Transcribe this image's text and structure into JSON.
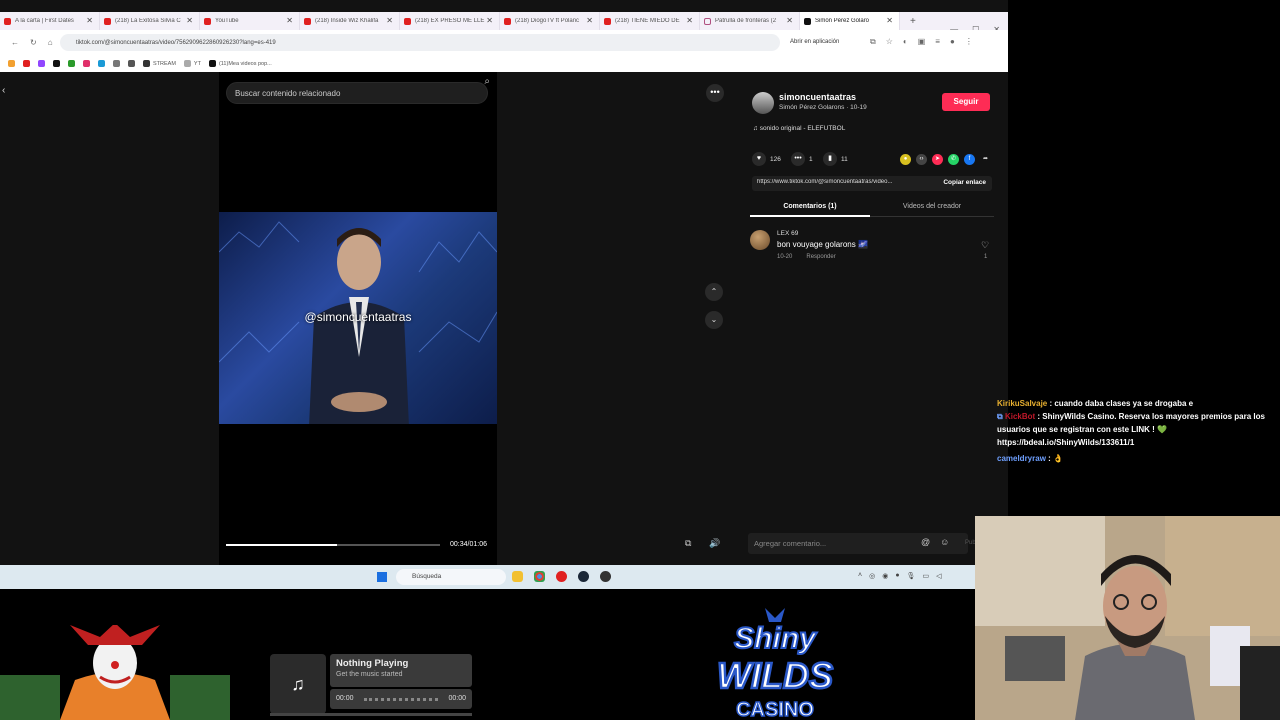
{
  "browser": {
    "tabs": [
      {
        "label": "A la carta | First Dates",
        "icon": "youtube-icon"
      },
      {
        "label": "(218) La Exitosa Silvia C",
        "icon": "youtube-icon"
      },
      {
        "label": "YouTube",
        "icon": "youtube-icon"
      },
      {
        "label": "(218) Inside Wiz Khalifa",
        "icon": "youtube-icon"
      },
      {
        "label": "(218) EX PRESO ME LLE",
        "icon": "youtube-icon"
      },
      {
        "label": "(218) DiogoTV ft Polanc",
        "icon": "youtube-icon"
      },
      {
        "label": "(218) TIENE MIEDO DE",
        "icon": "youtube-icon"
      },
      {
        "label": "Patrulla de fronteras (2",
        "icon": "page-icon"
      },
      {
        "label": "Simón Pérez Golaro",
        "icon": "tiktok-icon",
        "active": true
      }
    ],
    "url": "tiktok.com/@simoncuentaatras/video/7562909622860926230?lang=es-419",
    "open_in_app": "Abrir en aplicación",
    "bookmarks": [
      "",
      "",
      "",
      "",
      "",
      "",
      "",
      "",
      "",
      "",
      "",
      "STREAM",
      "",
      "YT",
      "(11)Mea videos pop..."
    ]
  },
  "tiktok": {
    "search_placeholder": "Buscar contenido relacionado",
    "watermark": "@simoncuentaatras",
    "progress": 0.52,
    "time": "00:34/01:06",
    "user": {
      "handle": "simoncuentaatras",
      "subtitle": "Simón Pérez Golarons · 10-19",
      "follow": "Seguir"
    },
    "sound": "sonido original - ELEFUTBOL",
    "stats": {
      "likes": "126",
      "comments": "1",
      "saves": "11"
    },
    "link": "https://www.tiktok.com/@simoncuentaatras/video...",
    "copy_link": "Copiar enlace",
    "tabs": {
      "comments": "Comentarios (1)",
      "videos": "Videos del creador"
    },
    "comment": {
      "user": "LEX 69",
      "text": "bon vouyage golarons 🌌",
      "date": "10-20",
      "reply": "Responder",
      "likes": "1"
    },
    "comment_placeholder": "Agregar comentario...",
    "post": "Publ"
  },
  "taskbar": {
    "search": "Búsqueda"
  },
  "chat": [
    {
      "user": "KirikuSalvaje",
      "text": " : cuando daba clases ya se drogaba e"
    },
    {
      "user": "KickBot",
      "text": " : ShinyWilds Casino. Reserva los mayores premios para los usuarios que se registran con este LINK ! 💚 https://bdeal.io/ShinyWilds/133611/1"
    },
    {
      "user": "cameldryraw",
      "text": " : 👌"
    }
  ],
  "player": {
    "title": "Nothing Playing",
    "subtitle": "Get the music started",
    "start": "00:00",
    "end": "00:00"
  },
  "logo": {
    "line1": "Shiny",
    "line2": "WILDS",
    "line3": "CASINO"
  },
  "colors": {
    "follow": "#fe2c55",
    "chat_user1": "#e8b030",
    "chat_user2": "#c0182a",
    "chat_user3": "#6fa0ff",
    "logo_blue": "#2a58c8"
  }
}
